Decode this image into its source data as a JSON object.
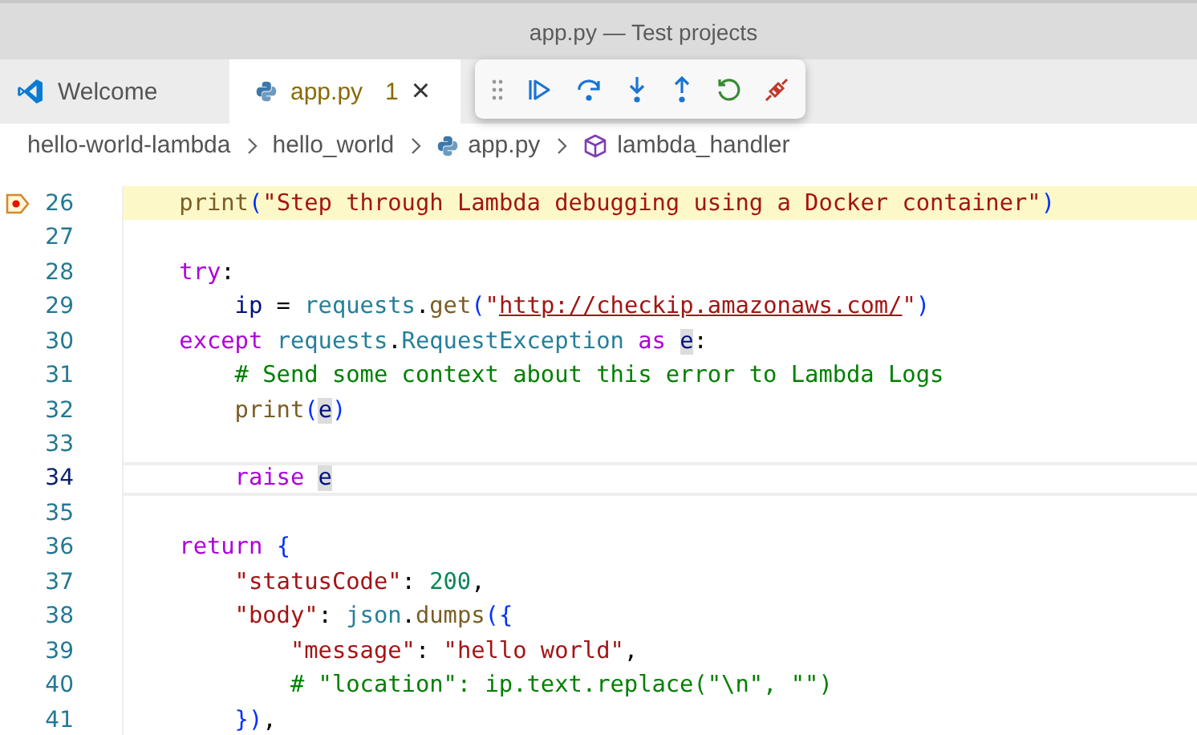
{
  "window": {
    "title": "app.py — Test projects"
  },
  "tabs": [
    {
      "label": "Welcome",
      "selected": false
    },
    {
      "label": "app.py",
      "selected": true,
      "badge": "1",
      "close": "×"
    }
  ],
  "debug_toolbar": [
    {
      "kind": "grip"
    },
    {
      "kind": "continue"
    },
    {
      "kind": "step-over"
    },
    {
      "kind": "step-into"
    },
    {
      "kind": "step-out"
    },
    {
      "kind": "restart"
    },
    {
      "kind": "disconnect"
    }
  ],
  "breadcrumbs": [
    {
      "label": "hello-world-lambda"
    },
    {
      "label": "hello_world"
    },
    {
      "label": "app.py"
    },
    {
      "label": "lambda_handler"
    }
  ],
  "editor": {
    "lines": [
      {
        "number": "26",
        "breakpoint": true,
        "paused": true,
        "current": false,
        "tokens": [
          {
            "kind": "fn",
            "t": "    print"
          },
          {
            "kind": "br",
            "t": "("
          },
          {
            "kind": "str",
            "t": "\"Step through Lambda debugging using a Docker container\""
          },
          {
            "kind": "br",
            "t": ")"
          }
        ]
      },
      {
        "number": "27",
        "breakpoint": false,
        "paused": false,
        "current": false
      },
      {
        "number": "28",
        "breakpoint": false,
        "paused": false,
        "current": false,
        "tokens": [
          {
            "kind": "kw",
            "t": "    try"
          },
          {
            "kind": "p",
            "t": ":"
          }
        ]
      },
      {
        "number": "29",
        "breakpoint": false,
        "paused": false,
        "current": false,
        "tokens": [
          {
            "kind": "var",
            "t": "        ip"
          },
          {
            "kind": "p",
            "t": " = "
          },
          {
            "kind": "cls",
            "t": "requests"
          },
          {
            "kind": "p",
            "t": "."
          },
          {
            "kind": "fn",
            "t": "get"
          },
          {
            "kind": "br",
            "t": "("
          },
          {
            "kind": "str",
            "t": "\""
          },
          {
            "kind": "link",
            "t": "http://checkip.amazonaws.com/"
          },
          {
            "kind": "str",
            "t": "\""
          },
          {
            "kind": "br",
            "t": ")"
          }
        ]
      },
      {
        "number": "30",
        "breakpoint": false,
        "paused": false,
        "current": false,
        "tokens": [
          {
            "kind": "kw",
            "t": "    except "
          },
          {
            "kind": "cls",
            "t": "requests"
          },
          {
            "kind": "p",
            "t": "."
          },
          {
            "kind": "cls",
            "t": "RequestException "
          },
          {
            "kind": "kw",
            "t": "as "
          },
          {
            "kind": "var",
            "t": "e",
            "occurrence": true
          },
          {
            "kind": "p",
            "t": ":"
          }
        ]
      },
      {
        "number": "31",
        "breakpoint": false,
        "paused": false,
        "current": false,
        "tokens": [
          {
            "kind": "cmt",
            "t": "        # Send some context about this error to Lambda Logs"
          }
        ]
      },
      {
        "number": "32",
        "breakpoint": false,
        "paused": false,
        "current": false,
        "tokens": [
          {
            "kind": "fn",
            "t": "        print"
          },
          {
            "kind": "br",
            "t": "("
          },
          {
            "kind": "var",
            "t": "e",
            "occurrence": true
          },
          {
            "kind": "br",
            "t": ")"
          }
        ]
      },
      {
        "number": "33",
        "breakpoint": false,
        "paused": false,
        "current": false
      },
      {
        "number": "34",
        "breakpoint": false,
        "paused": false,
        "current": true,
        "tokens": [
          {
            "kind": "kw",
            "t": "        raise "
          },
          {
            "kind": "var",
            "t": "e",
            "occurrence": true
          }
        ]
      },
      {
        "number": "35",
        "breakpoint": false,
        "paused": false,
        "current": false
      },
      {
        "number": "36",
        "breakpoint": false,
        "paused": false,
        "current": false,
        "tokens": [
          {
            "kind": "kw",
            "t": "    return "
          },
          {
            "kind": "br",
            "t": "{"
          }
        ]
      },
      {
        "number": "37",
        "breakpoint": false,
        "paused": false,
        "current": false,
        "tokens": [
          {
            "kind": "str",
            "t": "        \"statusCode\""
          },
          {
            "kind": "p",
            "t": ": "
          },
          {
            "kind": "num",
            "t": "200"
          },
          {
            "kind": "p",
            "t": ","
          }
        ]
      },
      {
        "number": "38",
        "breakpoint": false,
        "paused": false,
        "current": false,
        "tokens": [
          {
            "kind": "str",
            "t": "        \"body\""
          },
          {
            "kind": "p",
            "t": ": "
          },
          {
            "kind": "cls",
            "t": "json"
          },
          {
            "kind": "p",
            "t": "."
          },
          {
            "kind": "fn",
            "t": "dumps"
          },
          {
            "kind": "br",
            "t": "({"
          }
        ]
      },
      {
        "number": "39",
        "breakpoint": false,
        "paused": false,
        "current": false,
        "tokens": [
          {
            "kind": "str",
            "t": "            \"message\""
          },
          {
            "kind": "p",
            "t": ": "
          },
          {
            "kind": "str",
            "t": "\"hello world\""
          },
          {
            "kind": "p",
            "t": ","
          }
        ]
      },
      {
        "number": "40",
        "breakpoint": false,
        "paused": false,
        "current": false,
        "tokens": [
          {
            "kind": "cmt",
            "t": "            # \"location\": ip.text.replace(\"\\n\", \"\")"
          }
        ]
      },
      {
        "number": "41",
        "breakpoint": false,
        "paused": false,
        "current": false,
        "tokens": [
          {
            "kind": "br",
            "t": "        })"
          },
          {
            "kind": "p",
            "t": ","
          }
        ]
      }
    ]
  }
}
